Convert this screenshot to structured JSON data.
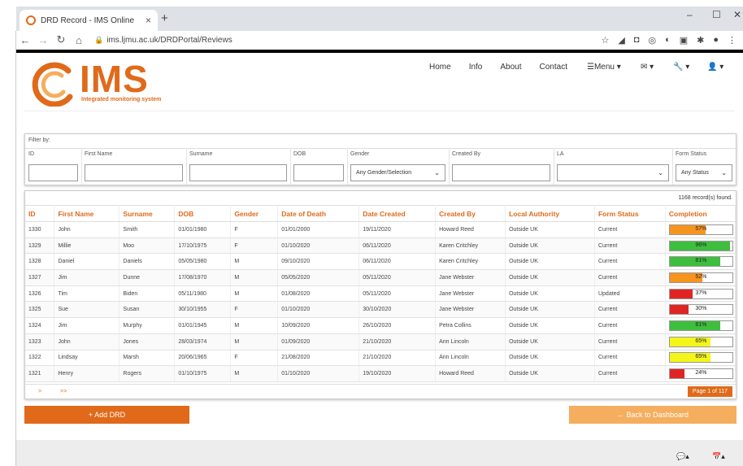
{
  "browser": {
    "tab_title": "DRD Record - IMS Online",
    "tab_close": "×",
    "new_tab": "+",
    "url": "ims.ljmu.ac.uk/DRDPortal/Reviews",
    "win_minimize": "–",
    "win_maximize": "☐",
    "win_close": "✕"
  },
  "logo": {
    "text": "IMS",
    "subtitle": "Integrated monitoring system"
  },
  "nav": {
    "home": "Home",
    "info": "Info",
    "about": "About",
    "contact": "Contact",
    "menu": "☰Menu ▾",
    "mail": "✉ ▾",
    "tools": "🔧 ▾",
    "user": "👤 ▾"
  },
  "filter": {
    "title": "Filter by:",
    "labels": {
      "id": "ID",
      "first_name": "First Name",
      "surname": "Surname",
      "dob": "DOB",
      "gender": "Gender",
      "created_by": "Created By",
      "la": "LA",
      "form_status": "Form Status"
    },
    "gender_value": "Any Gender/Selection",
    "form_status_value": "Any Status"
  },
  "table": {
    "found": "1168 record(s) found.",
    "headers": [
      "ID",
      "First Name",
      "Surname",
      "DOB",
      "Gender",
      "Date of Death",
      "Date Created",
      "Created By",
      "Local Authority",
      "Form Status",
      "Completion"
    ],
    "rows": [
      {
        "id": "1330",
        "first": "John",
        "surname": "Smith",
        "dob": "01/01/1980",
        "gender": "F",
        "dod": "01/01/2000",
        "created": "19/11/2020",
        "by": "Howard Reed",
        "la": "Outside UK",
        "status": "Current",
        "pct": "57%",
        "fill": 0.57,
        "color": "#f7941d"
      },
      {
        "id": "1329",
        "first": "Millie",
        "surname": "Moo",
        "dob": "17/10/1975",
        "gender": "F",
        "dod": "01/10/2020",
        "created": "06/11/2020",
        "by": "Karen Critchley",
        "la": "Outside UK",
        "status": "Current",
        "pct": "96%",
        "fill": 0.96,
        "color": "#3dbf3d"
      },
      {
        "id": "1328",
        "first": "Daniel",
        "surname": "Daniels",
        "dob": "05/05/1980",
        "gender": "M",
        "dod": "09/10/2020",
        "created": "06/11/2020",
        "by": "Karen Critchley",
        "la": "Outside UK",
        "status": "Current",
        "pct": "81%",
        "fill": 0.81,
        "color": "#3dbf3d"
      },
      {
        "id": "1327",
        "first": "Jim",
        "surname": "Dunne",
        "dob": "17/08/1970",
        "gender": "M",
        "dod": "05/05/2020",
        "created": "05/11/2020",
        "by": "Jane Webster",
        "la": "Outside UK",
        "status": "Current",
        "pct": "52%",
        "fill": 0.52,
        "color": "#f7941d"
      },
      {
        "id": "1326",
        "first": "Tim",
        "surname": "Biden",
        "dob": "05/11/1980",
        "gender": "M",
        "dod": "01/08/2020",
        "created": "05/11/2020",
        "by": "Jane Webster",
        "la": "Outside UK",
        "status": "Updated",
        "pct": "37%",
        "fill": 0.37,
        "color": "#e02424"
      },
      {
        "id": "1325",
        "first": "Sue",
        "surname": "Susan",
        "dob": "30/10/1955",
        "gender": "F",
        "dod": "01/10/2020",
        "created": "30/10/2020",
        "by": "Jane Webster",
        "la": "Outside UK",
        "status": "Current",
        "pct": "30%",
        "fill": 0.3,
        "color": "#e02424"
      },
      {
        "id": "1324",
        "first": "Jim",
        "surname": "Murphy",
        "dob": "01/01/1945",
        "gender": "M",
        "dod": "10/09/2020",
        "created": "26/10/2020",
        "by": "Petra Collins",
        "la": "Outside UK",
        "status": "Current",
        "pct": "81%",
        "fill": 0.81,
        "color": "#3dbf3d"
      },
      {
        "id": "1323",
        "first": "John",
        "surname": "Jones",
        "dob": "28/03/1974",
        "gender": "M",
        "dod": "01/09/2020",
        "created": "21/10/2020",
        "by": "Ann Lincoln",
        "la": "Outside UK",
        "status": "Current",
        "pct": "65%",
        "fill": 0.65,
        "color": "#f5f51a"
      },
      {
        "id": "1322",
        "first": "Lindsay",
        "surname": "Marsh",
        "dob": "20/06/1965",
        "gender": "F",
        "dod": "21/08/2020",
        "created": "21/10/2020",
        "by": "Ann Lincoln",
        "la": "Outside UK",
        "status": "Current",
        "pct": "65%",
        "fill": 0.65,
        "color": "#f5f51a"
      },
      {
        "id": "1321",
        "first": "Henry",
        "surname": "Rogers",
        "dob": "01/10/1975",
        "gender": "M",
        "dod": "01/10/2020",
        "created": "19/10/2020",
        "by": "Howard Reed",
        "la": "Outside UK",
        "status": "Current",
        "pct": "24%",
        "fill": 0.24,
        "color": "#e02424"
      }
    ]
  },
  "pager": {
    "next": ">",
    "last": ">>",
    "page_label": "Page 1 of 117"
  },
  "buttons": {
    "add": "+ Add DRD",
    "back": "← Back to Dashboard"
  },
  "colors": {
    "accent": "#e06a1a",
    "back_button": "#f4ae5e"
  }
}
